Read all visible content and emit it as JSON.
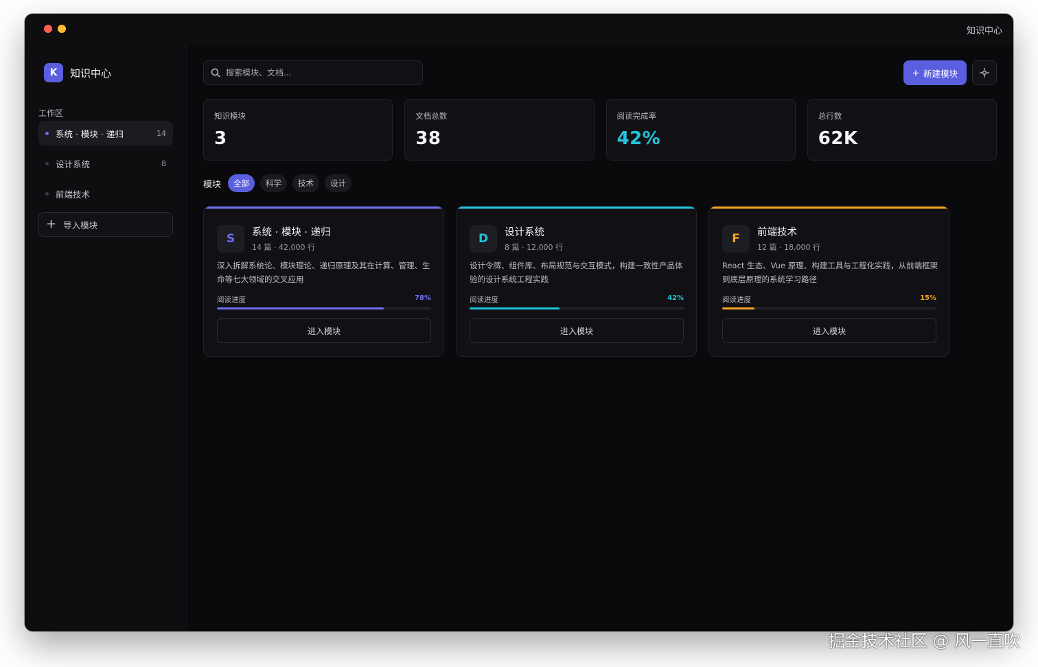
{
  "window": {
    "title": "知识中心"
  },
  "sidebar": {
    "brand_letter": "K",
    "brand_name": "知识中心",
    "section_label": "工作区",
    "items": [
      {
        "label": "系统 · 模块 · 递归",
        "count": "14",
        "active": true
      },
      {
        "label": "设计系统",
        "count": "8",
        "active": false
      },
      {
        "label": "前端技术",
        "count": "",
        "active": false
      }
    ],
    "import_label": "导入模块"
  },
  "header": {
    "search_placeholder": "搜索模块、文档...",
    "new_button_label": "新建模块",
    "accent": "#5a5fe0"
  },
  "stats": [
    {
      "label": "知识模块",
      "value": "3"
    },
    {
      "label": "文档总数",
      "value": "38"
    },
    {
      "label": "阅读完成率",
      "value": "42%",
      "color": "#22c3dc"
    },
    {
      "label": "总行数",
      "value": "62K"
    }
  ],
  "filters": {
    "label": "模块",
    "chips": [
      "全部",
      "科学",
      "技术",
      "设计"
    ],
    "active_index": 0
  },
  "cards": [
    {
      "letter": "S",
      "title": "系统 · 模块 · 递归",
      "meta": "14 篇 · 42,000 行",
      "desc": "深入拆解系统论、模块理论、递归原理及其在计算、管理、生命等七大领域的交叉应用",
      "progress_label": "阅读进度",
      "progress_value": "78%",
      "progress": 0.78,
      "color": "#6b6ff0",
      "button_label": "进入模块"
    },
    {
      "letter": "D",
      "title": "设计系统",
      "meta": "8 篇 · 12,000 行",
      "desc": "设计令牌、组件库、布局规范与交互模式，构建一致性产品体验的设计系统工程实践",
      "progress_label": "阅读进度",
      "progress_value": "42%",
      "progress": 0.42,
      "color": "#22c3dc",
      "button_label": "进入模块"
    },
    {
      "letter": "F",
      "title": "前端技术",
      "meta": "12 篇 · 18,000 行",
      "desc": "React 生态、Vue 原理、构建工具与工程化实践，从前端框架到底层原理的系统学习路径",
      "progress_label": "阅读进度",
      "progress_value": "15%",
      "progress": 0.15,
      "color": "#f5a524",
      "button_label": "进入模块"
    }
  ],
  "watermark": "掘金技术社区 @ 风一直吹",
  "icons": {
    "search": "search-icon",
    "plus": "plus-icon",
    "theme": "sun-icon"
  }
}
